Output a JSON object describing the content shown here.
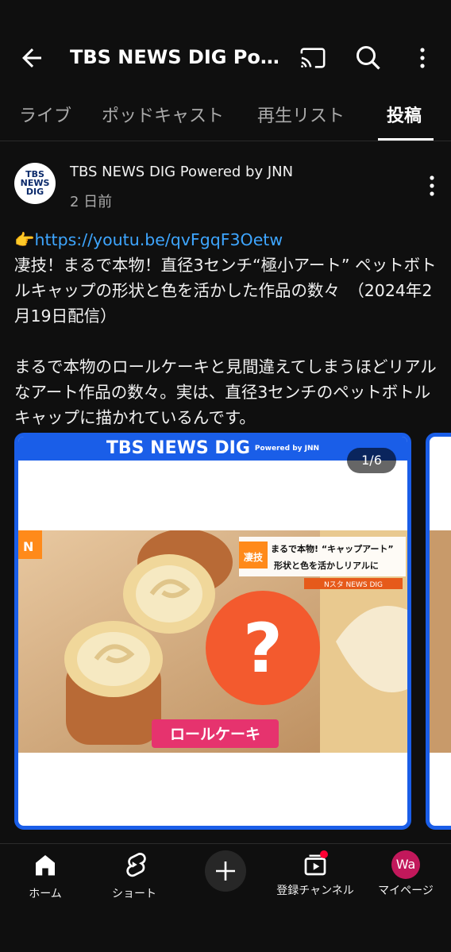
{
  "header": {
    "title": "TBS NEWS DIG Po…"
  },
  "tabs": [
    {
      "label": "ライブ"
    },
    {
      "label": "ポッドキャスト"
    },
    {
      "label": "再生リスト"
    },
    {
      "label": "投稿"
    }
  ],
  "post": {
    "channel": "TBS NEWS DIG Powered by JNN",
    "age": "2 日前",
    "avatar_text": "TBS NEWS DIG",
    "link_prefix": "👉",
    "link": "https://youtu.be/qvFgqF3Oetw",
    "headline": "凄技！まるで本物！直径3センチ“極小アート” ペットボトルキャップの形状と色を活かした作品の数々　（2024年2月19日配信）",
    "body": "まるで本物のロールケーキと見間違えてしまうほどリアルなアート作品の数々。実は、直径3センチのペットボトルキャップに描かれているんです。"
  },
  "carousel": {
    "banner": "TBS NEWS DIG",
    "banner_sub": "Powered by JNN",
    "counter": "1/6",
    "caption_left_tag": "凄技",
    "caption_line1": "まるで本物! “キャップアート”",
    "caption_line2": "形状と色を活かしリアルに",
    "source": "Nスタ NEWS DIG",
    "label": "ロールケーキ",
    "question": "?"
  },
  "bottom_nav": [
    {
      "label": "ホーム",
      "icon": "home-icon"
    },
    {
      "label": "ショート",
      "icon": "shorts-icon"
    },
    {
      "label": "",
      "icon": "create-icon"
    },
    {
      "label": "登録チャンネル",
      "icon": "subscriptions-icon"
    },
    {
      "label": "マイページ",
      "icon": "avatar"
    }
  ],
  "me": {
    "initials": "Wa"
  },
  "colors": {
    "background": "#0f0f0f",
    "link": "#3ea6ff",
    "brand_blue": "#1a5ee8",
    "accent_red": "#ff0033"
  }
}
